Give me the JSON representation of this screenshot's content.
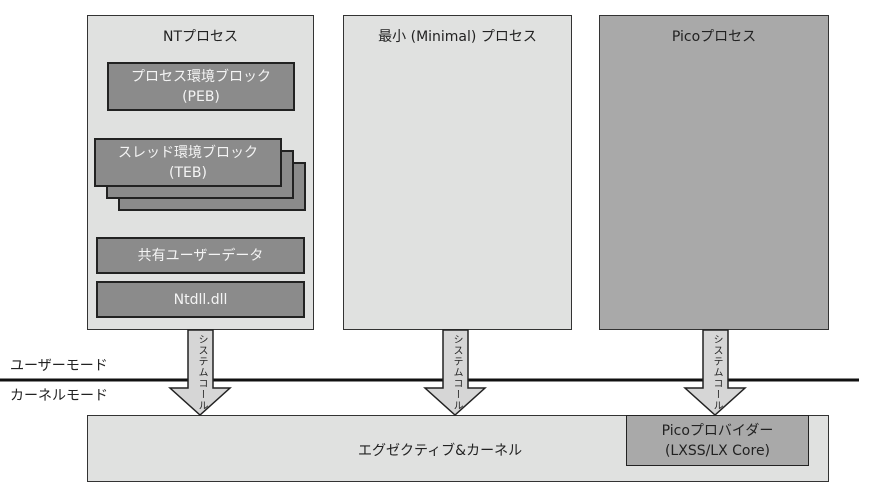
{
  "processes": {
    "nt": {
      "title": "NTプロセス",
      "peb": [
        "プロセス環境ブロック",
        "(PEB)"
      ],
      "teb": [
        "スレッド環境ブロック",
        "(TEB)"
      ],
      "shared_user_data": "共有ユーザーデータ",
      "ntdll": "Ntdll.dll"
    },
    "minimal": {
      "title": "最小 (Minimal) プロセス"
    },
    "pico": {
      "title": "Picoプロセス"
    }
  },
  "modes": {
    "user": "ユーザーモード",
    "kernel": "カーネルモード"
  },
  "arrow_label": "システムコール",
  "kernel": {
    "title": "エグゼクティブ&カーネル",
    "pico_provider": [
      "Picoプロバイダー",
      "(LXSS/LX Core)"
    ]
  },
  "colors": {
    "light": "#e0e1e0",
    "mid": "#a9a9a9",
    "dark": "#8b8b8b"
  }
}
